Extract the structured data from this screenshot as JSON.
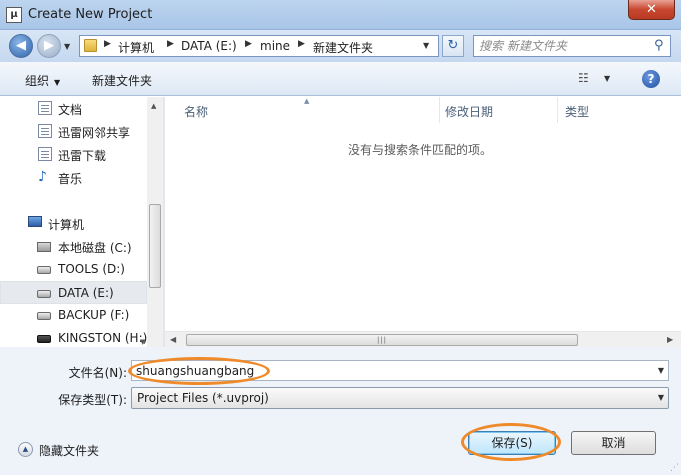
{
  "window": {
    "title": "Create New Project",
    "app_icon_glyph": "μ",
    "close_glyph": "✕"
  },
  "nav": {
    "back_glyph": "◀",
    "forward_glyph": "▶",
    "recent_glyph": "▼",
    "refresh_glyph": "↻"
  },
  "address": {
    "breadcrumb": [
      "计算机",
      "DATA (E:)",
      "mine",
      "新建文件夹"
    ],
    "separator": "▶",
    "dropdown_glyph": "▼"
  },
  "search": {
    "placeholder": "搜索 新建文件夹",
    "icon_glyph": "⚲"
  },
  "toolbar": {
    "organize_label": "组织",
    "organize_arrow": "▼",
    "new_folder_label": "新建文件夹",
    "view_glyph": "☷",
    "view_arrow": "▼",
    "help_glyph": "?"
  },
  "sidebar": {
    "up_arrow": "▲",
    "down_arrow": "▼",
    "items": [
      {
        "label": "文档",
        "icon": "document-icon"
      },
      {
        "label": "迅雷网邻共享",
        "icon": "document-icon"
      },
      {
        "label": "迅雷下载",
        "icon": "document-icon"
      },
      {
        "label": "音乐",
        "icon": "music-note-icon",
        "glyph": "♪"
      },
      {
        "label": "计算机",
        "icon": "computer-icon"
      },
      {
        "label": "本地磁盘 (C:)",
        "icon": "system-drive-icon"
      },
      {
        "label": "TOOLS (D:)",
        "icon": "drive-icon"
      },
      {
        "label": "DATA (E:)",
        "icon": "drive-icon",
        "selected": true
      },
      {
        "label": "BACKUP (F:)",
        "icon": "drive-icon"
      },
      {
        "label": "KINGSTON (H:)",
        "icon": "usb-drive-icon"
      }
    ]
  },
  "filelist": {
    "columns": [
      "名称",
      "修改日期",
      "类型"
    ],
    "sort_glyph": "▲",
    "empty_message": "没有与搜索条件匹配的项。",
    "hscroll": {
      "left_arrow": "◀",
      "right_arrow": "▶",
      "grip": "|||"
    }
  },
  "form": {
    "filename_label": "文件名(N):",
    "filename_value": "shuangshuangbang",
    "filetype_label": "保存类型(T):",
    "filetype_value": "Project Files (*.uvproj)",
    "dropdown_glyph": "▼",
    "hide_folders_label": "隐藏文件夹",
    "hide_folders_glyph": "▲",
    "save_label": "保存(S)",
    "cancel_label": "取消",
    "resize_grip": "⋰"
  },
  "colors": {
    "highlight_ring": "#ef8a2a",
    "title_bar": "#b6cfec",
    "close_button": "#c8472f"
  }
}
